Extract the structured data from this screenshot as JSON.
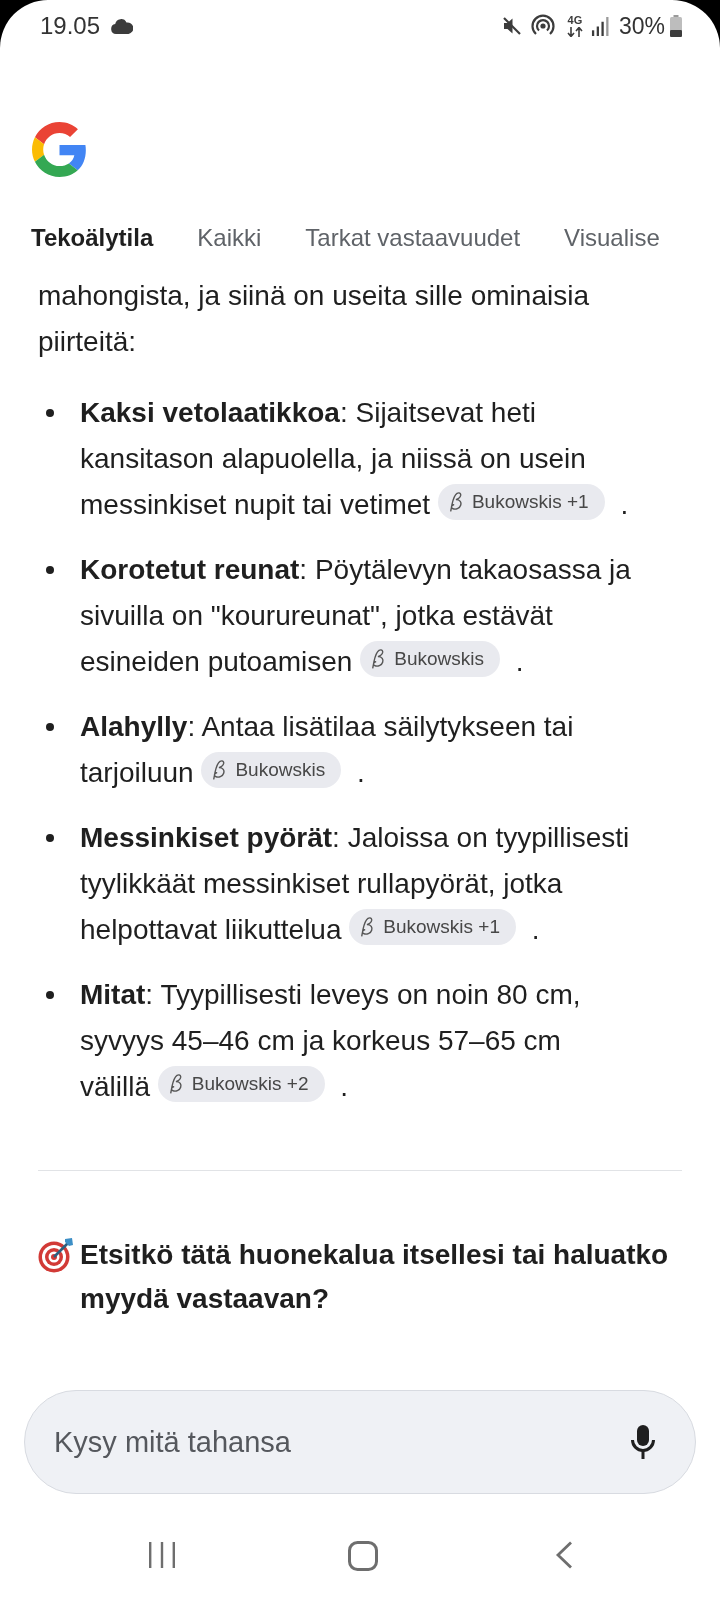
{
  "status_bar": {
    "time": "19.05",
    "network": "4G",
    "battery": "30%"
  },
  "tabs": [
    {
      "label": "Tekoälytila",
      "selected": true
    },
    {
      "label": "Kaikki",
      "selected": false
    },
    {
      "label": "Tarkat vastaavuudet",
      "selected": false
    },
    {
      "label": "Visualise",
      "selected": false
    }
  ],
  "answer": {
    "intro": "mahongista, ja siinä on useita sille ominaisia piirteitä:",
    "bullets": [
      {
        "text": "**Kaksi vetolaatikkoa**: Sijaitsevat heti kansitason alapuolella, ja niissä on usein messinkiset nupit tai vetimet",
        "source": "Bukowskis +1",
        "end": "."
      },
      {
        "text": "**Korotetut reunat**: Pöytälevyn takaosassa ja sivuilla on \"kourureunat\", jotka estävät esineiden putoamisen",
        "source": "Bukowskis",
        "end": "."
      },
      {
        "text": "**Alahylly**: Antaa lisätilaa säilytykseen tai tarjoiluun",
        "source": "Bukowskis",
        "end": "."
      },
      {
        "text": "**Messinkiset pyörät**: Jaloissa on tyypillisesti tyylikkäät messinkiset rullapyörät, jotka helpottavat liikuttelua",
        "source": "Bukowskis +1",
        "end": "."
      },
      {
        "text": "**Mitat**: Tyypillisesti leveys on noin 80 cm, syvyys 45–46 cm ja korkeus 57–65 cm välillä",
        "source": "Bukowskis +2",
        "end": "."
      }
    ]
  },
  "follow_up": {
    "heading": "Etsitkö tätä huonekalua itsellesi tai haluatko myydä vastaavan?"
  },
  "ask_bar": {
    "placeholder": "Kysy mitä tahansa"
  }
}
